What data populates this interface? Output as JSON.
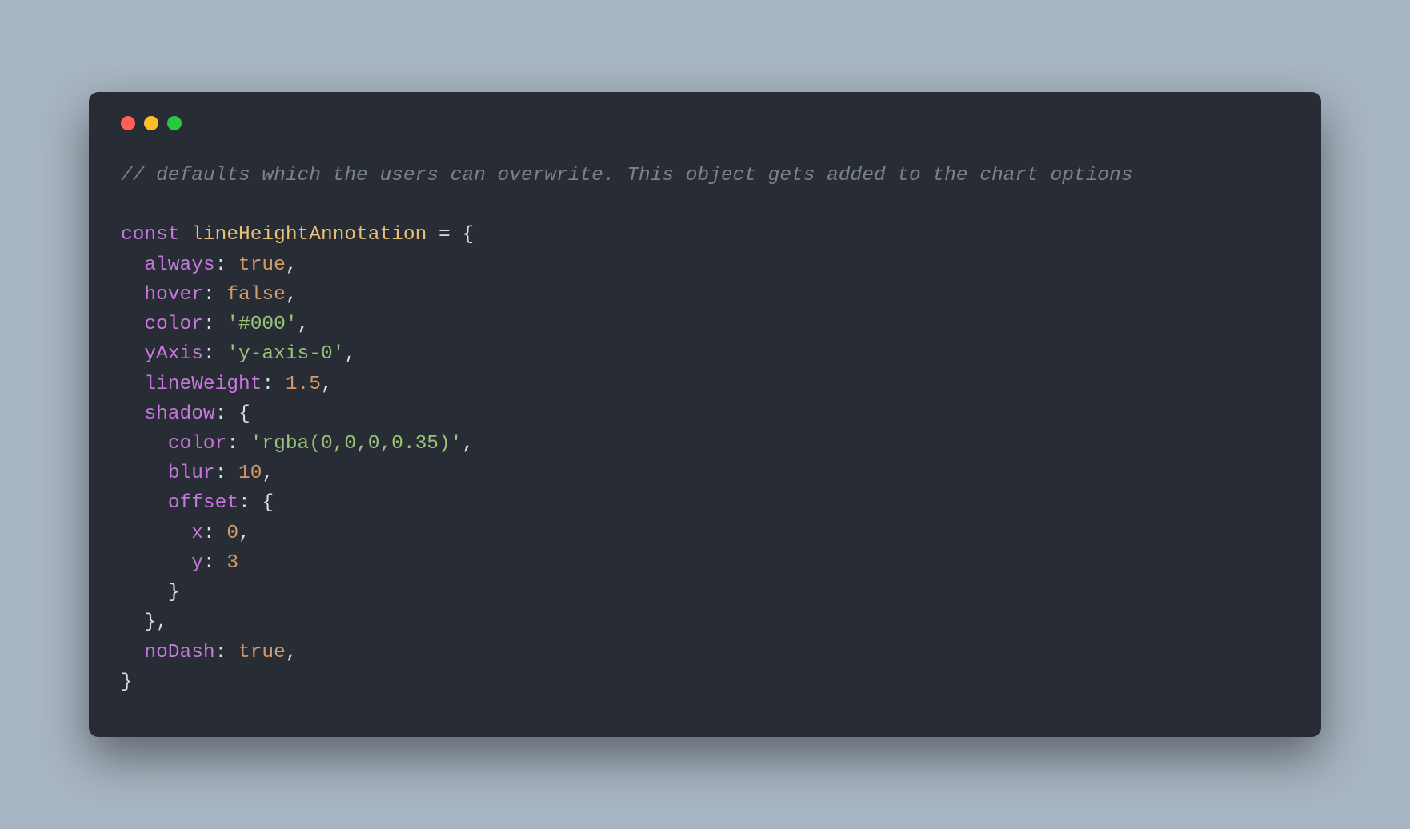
{
  "code": {
    "comment": "// defaults which the users can overwrite. This object gets added to the chart options",
    "const_kw": "const",
    "const_name": "lineHeightAnnotation",
    "equals": " = ",
    "brace_open": "{",
    "brace_close": "}",
    "comma": ",",
    "colon": ":",
    "props": {
      "always": "always",
      "hover": "hover",
      "color": "color",
      "yAxis": "yAxis",
      "lineWeight": "lineWeight",
      "shadow": "shadow",
      "blur": "blur",
      "offset": "offset",
      "x": "x",
      "y": "y",
      "noDash": "noDash"
    },
    "values": {
      "true": "true",
      "false": "false",
      "color_val": "'#000'",
      "yaxis_val": "'y-axis-0'",
      "lineweight_val": "1.5",
      "shadow_color_val": "'rgba(0,0,0,0.35)'",
      "blur_val": "10",
      "x_val": "0",
      "y_val": "3"
    }
  }
}
